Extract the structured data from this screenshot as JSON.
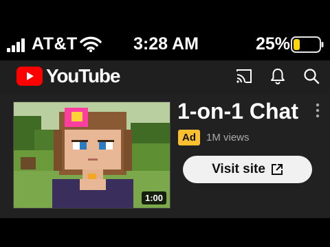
{
  "status_bar": {
    "carrier": "AT&T",
    "time": "3:28 AM",
    "battery_percent": "25%",
    "battery_level": 0.25,
    "battery_color": "#ffd60a",
    "signal_icon": "cellular-signal-icon",
    "wifi_icon": "wifi-icon"
  },
  "header": {
    "logo_text": "YouTube",
    "logo_color": "#ff0000",
    "icons": [
      "cast-icon",
      "notifications-bell-icon",
      "search-icon"
    ]
  },
  "ad_card": {
    "title": "1-on-1 Chat",
    "badge": "Ad",
    "views": "1M views",
    "duration": "1:00",
    "cta_label": "Visit site",
    "cta_icon": "open-external-icon",
    "menu_icon": "more-vert-icon",
    "badge_color": "#fbc02d"
  }
}
